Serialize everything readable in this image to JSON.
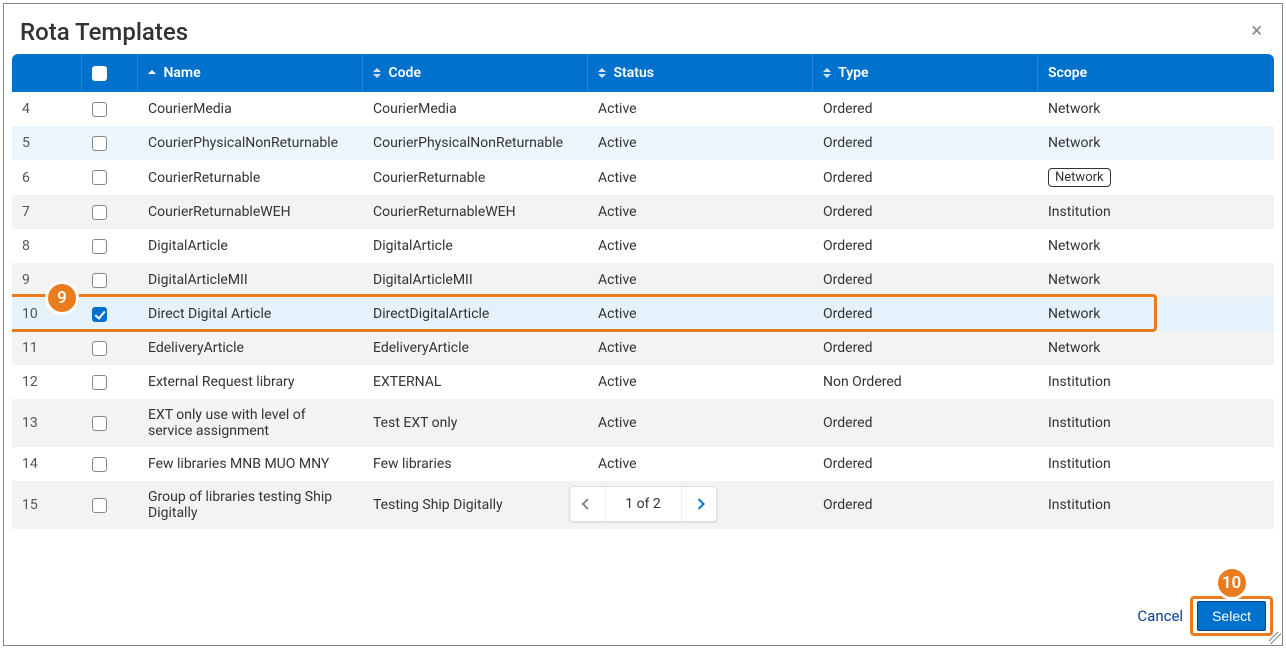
{
  "modal": {
    "title": "Rota Templates"
  },
  "columns": {
    "name": "Name",
    "code": "Code",
    "status": "Status",
    "type": "Type",
    "scope": "Scope"
  },
  "rows": [
    {
      "idx": "4",
      "checked": false,
      "name": "CourierMedia",
      "code": "CourierMedia",
      "status": "Active",
      "type": "Ordered",
      "scope": "Network",
      "scope_boxed": false
    },
    {
      "idx": "5",
      "checked": false,
      "name": "CourierPhysicalNonReturnable",
      "code": "CourierPhysicalNonReturnable",
      "status": "Active",
      "type": "Ordered",
      "scope": "Network",
      "scope_boxed": false
    },
    {
      "idx": "6",
      "checked": false,
      "name": "CourierReturnable",
      "code": "CourierReturnable",
      "status": "Active",
      "type": "Ordered",
      "scope": "Network",
      "scope_boxed": true
    },
    {
      "idx": "7",
      "checked": false,
      "name": "CourierReturnableWEH",
      "code": "CourierReturnableWEH",
      "status": "Active",
      "type": "Ordered",
      "scope": "Institution",
      "scope_boxed": false
    },
    {
      "idx": "8",
      "checked": false,
      "name": "DigitalArticle",
      "code": "DigitalArticle",
      "status": "Active",
      "type": "Ordered",
      "scope": "Network",
      "scope_boxed": false
    },
    {
      "idx": "9",
      "checked": false,
      "name": "DigitalArticleMII",
      "code": "DigitalArticleMII",
      "status": "Active",
      "type": "Ordered",
      "scope": "Network",
      "scope_boxed": false
    },
    {
      "idx": "10",
      "checked": true,
      "name": "Direct Digital Article",
      "code": "DirectDigitalArticle",
      "status": "Active",
      "type": "Ordered",
      "scope": "Network",
      "scope_boxed": false
    },
    {
      "idx": "11",
      "checked": false,
      "name": "EdeliveryArticle",
      "code": "EdeliveryArticle",
      "status": "Active",
      "type": "Ordered",
      "scope": "Network",
      "scope_boxed": false
    },
    {
      "idx": "12",
      "checked": false,
      "name": "External Request library",
      "code": "EXTERNAL",
      "status": "Active",
      "type": "Non Ordered",
      "scope": "Institution",
      "scope_boxed": false
    },
    {
      "idx": "13",
      "checked": false,
      "name": "EXT only use with level of service assignment",
      "code": "Test EXT only",
      "status": "Active",
      "type": "Ordered",
      "scope": "Institution",
      "scope_boxed": false
    },
    {
      "idx": "14",
      "checked": false,
      "name": "Few libraries MNB MUO MNY",
      "code": "Few libraries",
      "status": "Active",
      "type": "Ordered",
      "scope": "Institution",
      "scope_boxed": false
    },
    {
      "idx": "15",
      "checked": false,
      "name": "Group of libraries testing Ship Digitally",
      "code": "Testing Ship Digitally",
      "status": "",
      "type": "Ordered",
      "scope": "Institution",
      "scope_boxed": false
    }
  ],
  "pagination": {
    "label": "1 of 2"
  },
  "footer": {
    "cancel": "Cancel",
    "select": "Select"
  },
  "annotations": {
    "nine": "9",
    "ten": "10"
  }
}
